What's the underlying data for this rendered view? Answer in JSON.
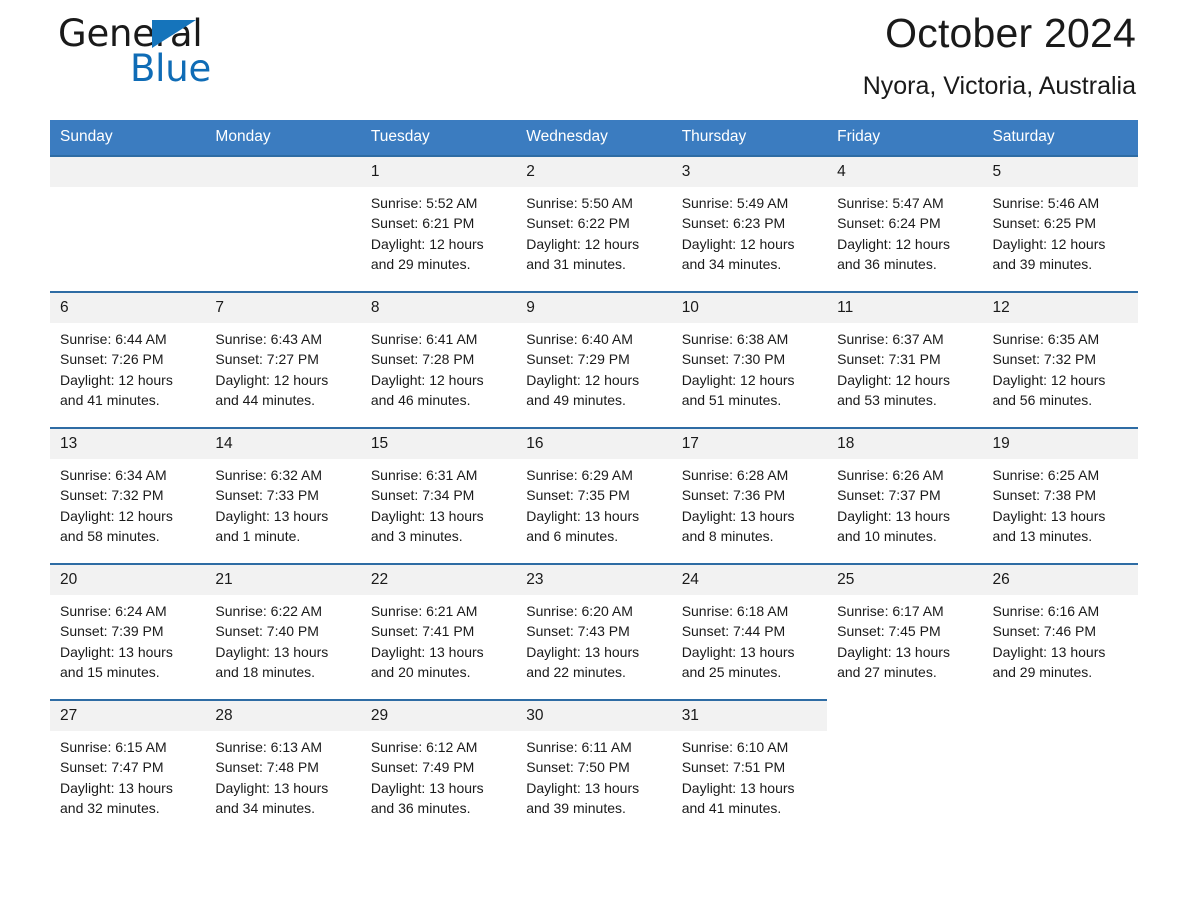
{
  "brand": {
    "word1": "General",
    "word2": "Blue",
    "triangle_color": "#1574bb",
    "blue_color": "#0f6cb6"
  },
  "header": {
    "title": "October 2024",
    "subtitle": "Nyora, Victoria, Australia",
    "header_bg": "#3b7cc0",
    "row_border_color": "#2e6ca4",
    "daynum_bg": "#f2f2f2"
  },
  "calendar": {
    "weekday_headers": [
      "Sunday",
      "Monday",
      "Tuesday",
      "Wednesday",
      "Thursday",
      "Friday",
      "Saturday"
    ],
    "weeks": [
      [
        {
          "day": "",
          "empty": true
        },
        {
          "day": "",
          "empty": true
        },
        {
          "day": "1",
          "sunrise": "Sunrise: 5:52 AM",
          "sunset": "Sunset: 6:21 PM",
          "daylight1": "Daylight: 12 hours",
          "daylight2": "and 29 minutes."
        },
        {
          "day": "2",
          "sunrise": "Sunrise: 5:50 AM",
          "sunset": "Sunset: 6:22 PM",
          "daylight1": "Daylight: 12 hours",
          "daylight2": "and 31 minutes."
        },
        {
          "day": "3",
          "sunrise": "Sunrise: 5:49 AM",
          "sunset": "Sunset: 6:23 PM",
          "daylight1": "Daylight: 12 hours",
          "daylight2": "and 34 minutes."
        },
        {
          "day": "4",
          "sunrise": "Sunrise: 5:47 AM",
          "sunset": "Sunset: 6:24 PM",
          "daylight1": "Daylight: 12 hours",
          "daylight2": "and 36 minutes."
        },
        {
          "day": "5",
          "sunrise": "Sunrise: 5:46 AM",
          "sunset": "Sunset: 6:25 PM",
          "daylight1": "Daylight: 12 hours",
          "daylight2": "and 39 minutes."
        }
      ],
      [
        {
          "day": "6",
          "sunrise": "Sunrise: 6:44 AM",
          "sunset": "Sunset: 7:26 PM",
          "daylight1": "Daylight: 12 hours",
          "daylight2": "and 41 minutes."
        },
        {
          "day": "7",
          "sunrise": "Sunrise: 6:43 AM",
          "sunset": "Sunset: 7:27 PM",
          "daylight1": "Daylight: 12 hours",
          "daylight2": "and 44 minutes."
        },
        {
          "day": "8",
          "sunrise": "Sunrise: 6:41 AM",
          "sunset": "Sunset: 7:28 PM",
          "daylight1": "Daylight: 12 hours",
          "daylight2": "and 46 minutes."
        },
        {
          "day": "9",
          "sunrise": "Sunrise: 6:40 AM",
          "sunset": "Sunset: 7:29 PM",
          "daylight1": "Daylight: 12 hours",
          "daylight2": "and 49 minutes."
        },
        {
          "day": "10",
          "sunrise": "Sunrise: 6:38 AM",
          "sunset": "Sunset: 7:30 PM",
          "daylight1": "Daylight: 12 hours",
          "daylight2": "and 51 minutes."
        },
        {
          "day": "11",
          "sunrise": "Sunrise: 6:37 AM",
          "sunset": "Sunset: 7:31 PM",
          "daylight1": "Daylight: 12 hours",
          "daylight2": "and 53 minutes."
        },
        {
          "day": "12",
          "sunrise": "Sunrise: 6:35 AM",
          "sunset": "Sunset: 7:32 PM",
          "daylight1": "Daylight: 12 hours",
          "daylight2": "and 56 minutes."
        }
      ],
      [
        {
          "day": "13",
          "sunrise": "Sunrise: 6:34 AM",
          "sunset": "Sunset: 7:32 PM",
          "daylight1": "Daylight: 12 hours",
          "daylight2": "and 58 minutes."
        },
        {
          "day": "14",
          "sunrise": "Sunrise: 6:32 AM",
          "sunset": "Sunset: 7:33 PM",
          "daylight1": "Daylight: 13 hours",
          "daylight2": "and 1 minute."
        },
        {
          "day": "15",
          "sunrise": "Sunrise: 6:31 AM",
          "sunset": "Sunset: 7:34 PM",
          "daylight1": "Daylight: 13 hours",
          "daylight2": "and 3 minutes."
        },
        {
          "day": "16",
          "sunrise": "Sunrise: 6:29 AM",
          "sunset": "Sunset: 7:35 PM",
          "daylight1": "Daylight: 13 hours",
          "daylight2": "and 6 minutes."
        },
        {
          "day": "17",
          "sunrise": "Sunrise: 6:28 AM",
          "sunset": "Sunset: 7:36 PM",
          "daylight1": "Daylight: 13 hours",
          "daylight2": "and 8 minutes."
        },
        {
          "day": "18",
          "sunrise": "Sunrise: 6:26 AM",
          "sunset": "Sunset: 7:37 PM",
          "daylight1": "Daylight: 13 hours",
          "daylight2": "and 10 minutes."
        },
        {
          "day": "19",
          "sunrise": "Sunrise: 6:25 AM",
          "sunset": "Sunset: 7:38 PM",
          "daylight1": "Daylight: 13 hours",
          "daylight2": "and 13 minutes."
        }
      ],
      [
        {
          "day": "20",
          "sunrise": "Sunrise: 6:24 AM",
          "sunset": "Sunset: 7:39 PM",
          "daylight1": "Daylight: 13 hours",
          "daylight2": "and 15 minutes."
        },
        {
          "day": "21",
          "sunrise": "Sunrise: 6:22 AM",
          "sunset": "Sunset: 7:40 PM",
          "daylight1": "Daylight: 13 hours",
          "daylight2": "and 18 minutes."
        },
        {
          "day": "22",
          "sunrise": "Sunrise: 6:21 AM",
          "sunset": "Sunset: 7:41 PM",
          "daylight1": "Daylight: 13 hours",
          "daylight2": "and 20 minutes."
        },
        {
          "day": "23",
          "sunrise": "Sunrise: 6:20 AM",
          "sunset": "Sunset: 7:43 PM",
          "daylight1": "Daylight: 13 hours",
          "daylight2": "and 22 minutes."
        },
        {
          "day": "24",
          "sunrise": "Sunrise: 6:18 AM",
          "sunset": "Sunset: 7:44 PM",
          "daylight1": "Daylight: 13 hours",
          "daylight2": "and 25 minutes."
        },
        {
          "day": "25",
          "sunrise": "Sunrise: 6:17 AM",
          "sunset": "Sunset: 7:45 PM",
          "daylight1": "Daylight: 13 hours",
          "daylight2": "and 27 minutes."
        },
        {
          "day": "26",
          "sunrise": "Sunrise: 6:16 AM",
          "sunset": "Sunset: 7:46 PM",
          "daylight1": "Daylight: 13 hours",
          "daylight2": "and 29 minutes."
        }
      ],
      [
        {
          "day": "27",
          "sunrise": "Sunrise: 6:15 AM",
          "sunset": "Sunset: 7:47 PM",
          "daylight1": "Daylight: 13 hours",
          "daylight2": "and 32 minutes."
        },
        {
          "day": "28",
          "sunrise": "Sunrise: 6:13 AM",
          "sunset": "Sunset: 7:48 PM",
          "daylight1": "Daylight: 13 hours",
          "daylight2": "and 34 minutes."
        },
        {
          "day": "29",
          "sunrise": "Sunrise: 6:12 AM",
          "sunset": "Sunset: 7:49 PM",
          "daylight1": "Daylight: 13 hours",
          "daylight2": "and 36 minutes."
        },
        {
          "day": "30",
          "sunrise": "Sunrise: 6:11 AM",
          "sunset": "Sunset: 7:50 PM",
          "daylight1": "Daylight: 13 hours",
          "daylight2": "and 39 minutes."
        },
        {
          "day": "31",
          "sunrise": "Sunrise: 6:10 AM",
          "sunset": "Sunset: 7:51 PM",
          "daylight1": "Daylight: 13 hours",
          "daylight2": "and 41 minutes."
        },
        {
          "day": "",
          "empty": true,
          "blank": true
        },
        {
          "day": "",
          "empty": true,
          "blank": true
        }
      ]
    ]
  }
}
